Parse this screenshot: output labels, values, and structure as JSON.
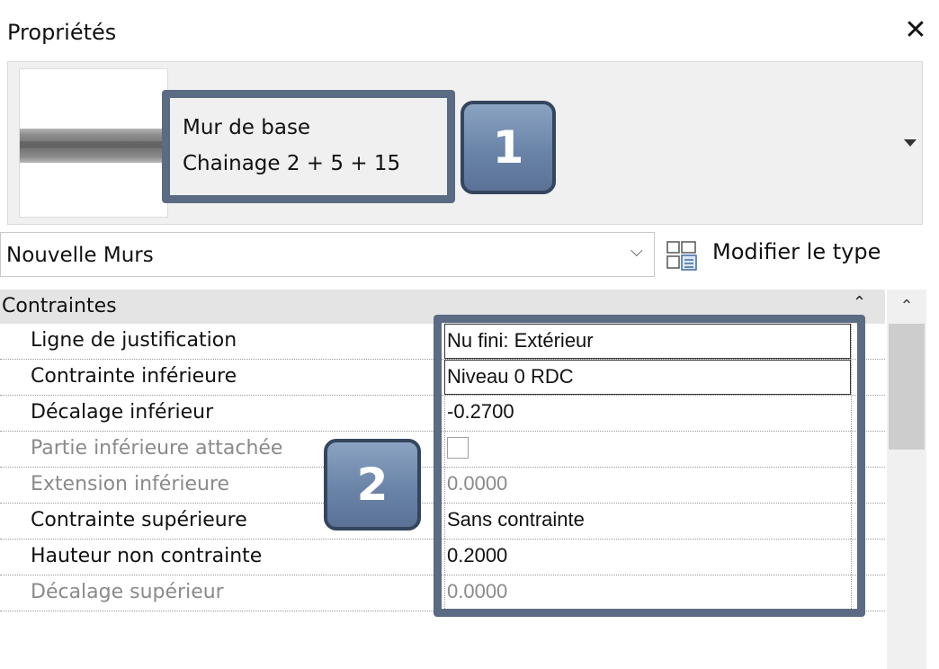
{
  "window": {
    "title": "Propriétés",
    "close_glyph": "✕"
  },
  "type_selector": {
    "family": "Mur de base",
    "type": "Chainage 2 + 5 + 15"
  },
  "callouts": [
    {
      "label": "1"
    },
    {
      "label": "2"
    }
  ],
  "filter": {
    "selected": "Nouvelle Murs",
    "chevron": "⌵",
    "edit_type_label": "Modifier le type"
  },
  "group": {
    "label": "Contraintes",
    "collapse_glyph": "⌃",
    "scroll_up_glyph": "⌃"
  },
  "properties": [
    {
      "name": "Ligne de justification",
      "value": "Nu fini: Extérieur",
      "enabled": true
    },
    {
      "name": "Contrainte inférieure",
      "value": "Niveau 0 RDC",
      "enabled": true
    },
    {
      "name": "Décalage inférieur",
      "value": "-0.2700",
      "enabled": true
    },
    {
      "name": "Partie inférieure attachée",
      "value": "",
      "enabled": false
    },
    {
      "name": "Extension inférieure",
      "value": "0.0000",
      "enabled": false
    },
    {
      "name": "Contrainte supérieure",
      "value": "Sans contrainte",
      "enabled": true
    },
    {
      "name": "Hauteur non contrainte",
      "value": "0.2000",
      "enabled": true
    },
    {
      "name": "Décalage supérieur",
      "value": "0.0000",
      "enabled": false
    }
  ],
  "colors": {
    "callout_border": "#5a6b83",
    "badge_fill": "#7088ab"
  }
}
